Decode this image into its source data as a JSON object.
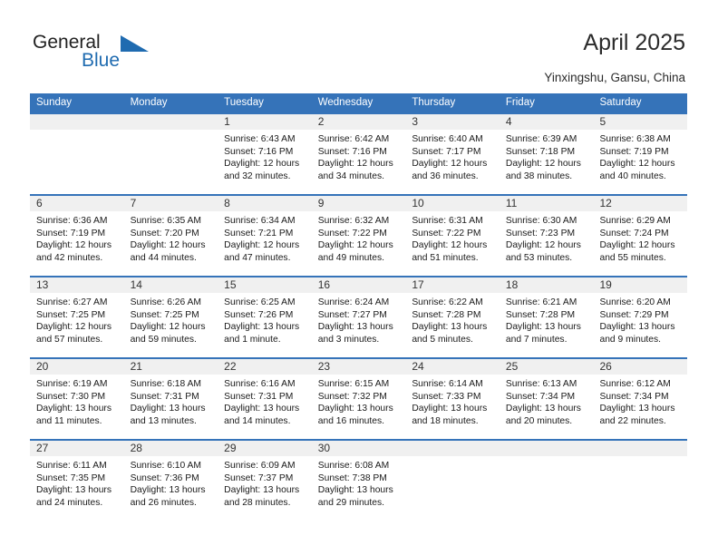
{
  "brand": {
    "name_part1": "General",
    "name_part2": "Blue",
    "accent_color": "#1f6bb0"
  },
  "header": {
    "title": "April 2025",
    "subtitle": "Yinxingshu, Gansu, China"
  },
  "calendar": {
    "header_bg": "#3573b9",
    "daynum_bg": "#f0f0f0",
    "weekdays": [
      "Sunday",
      "Monday",
      "Tuesday",
      "Wednesday",
      "Thursday",
      "Friday",
      "Saturday"
    ],
    "weeks": [
      [
        {
          "day": "",
          "sunrise": "",
          "sunset": "",
          "daylight1": "",
          "daylight2": ""
        },
        {
          "day": "",
          "sunrise": "",
          "sunset": "",
          "daylight1": "",
          "daylight2": ""
        },
        {
          "day": "1",
          "sunrise": "Sunrise: 6:43 AM",
          "sunset": "Sunset: 7:16 PM",
          "daylight1": "Daylight: 12 hours",
          "daylight2": "and 32 minutes."
        },
        {
          "day": "2",
          "sunrise": "Sunrise: 6:42 AM",
          "sunset": "Sunset: 7:16 PM",
          "daylight1": "Daylight: 12 hours",
          "daylight2": "and 34 minutes."
        },
        {
          "day": "3",
          "sunrise": "Sunrise: 6:40 AM",
          "sunset": "Sunset: 7:17 PM",
          "daylight1": "Daylight: 12 hours",
          "daylight2": "and 36 minutes."
        },
        {
          "day": "4",
          "sunrise": "Sunrise: 6:39 AM",
          "sunset": "Sunset: 7:18 PM",
          "daylight1": "Daylight: 12 hours",
          "daylight2": "and 38 minutes."
        },
        {
          "day": "5",
          "sunrise": "Sunrise: 6:38 AM",
          "sunset": "Sunset: 7:19 PM",
          "daylight1": "Daylight: 12 hours",
          "daylight2": "and 40 minutes."
        }
      ],
      [
        {
          "day": "6",
          "sunrise": "Sunrise: 6:36 AM",
          "sunset": "Sunset: 7:19 PM",
          "daylight1": "Daylight: 12 hours",
          "daylight2": "and 42 minutes."
        },
        {
          "day": "7",
          "sunrise": "Sunrise: 6:35 AM",
          "sunset": "Sunset: 7:20 PM",
          "daylight1": "Daylight: 12 hours",
          "daylight2": "and 44 minutes."
        },
        {
          "day": "8",
          "sunrise": "Sunrise: 6:34 AM",
          "sunset": "Sunset: 7:21 PM",
          "daylight1": "Daylight: 12 hours",
          "daylight2": "and 47 minutes."
        },
        {
          "day": "9",
          "sunrise": "Sunrise: 6:32 AM",
          "sunset": "Sunset: 7:22 PM",
          "daylight1": "Daylight: 12 hours",
          "daylight2": "and 49 minutes."
        },
        {
          "day": "10",
          "sunrise": "Sunrise: 6:31 AM",
          "sunset": "Sunset: 7:22 PM",
          "daylight1": "Daylight: 12 hours",
          "daylight2": "and 51 minutes."
        },
        {
          "day": "11",
          "sunrise": "Sunrise: 6:30 AM",
          "sunset": "Sunset: 7:23 PM",
          "daylight1": "Daylight: 12 hours",
          "daylight2": "and 53 minutes."
        },
        {
          "day": "12",
          "sunrise": "Sunrise: 6:29 AM",
          "sunset": "Sunset: 7:24 PM",
          "daylight1": "Daylight: 12 hours",
          "daylight2": "and 55 minutes."
        }
      ],
      [
        {
          "day": "13",
          "sunrise": "Sunrise: 6:27 AM",
          "sunset": "Sunset: 7:25 PM",
          "daylight1": "Daylight: 12 hours",
          "daylight2": "and 57 minutes."
        },
        {
          "day": "14",
          "sunrise": "Sunrise: 6:26 AM",
          "sunset": "Sunset: 7:25 PM",
          "daylight1": "Daylight: 12 hours",
          "daylight2": "and 59 minutes."
        },
        {
          "day": "15",
          "sunrise": "Sunrise: 6:25 AM",
          "sunset": "Sunset: 7:26 PM",
          "daylight1": "Daylight: 13 hours",
          "daylight2": "and 1 minute."
        },
        {
          "day": "16",
          "sunrise": "Sunrise: 6:24 AM",
          "sunset": "Sunset: 7:27 PM",
          "daylight1": "Daylight: 13 hours",
          "daylight2": "and 3 minutes."
        },
        {
          "day": "17",
          "sunrise": "Sunrise: 6:22 AM",
          "sunset": "Sunset: 7:28 PM",
          "daylight1": "Daylight: 13 hours",
          "daylight2": "and 5 minutes."
        },
        {
          "day": "18",
          "sunrise": "Sunrise: 6:21 AM",
          "sunset": "Sunset: 7:28 PM",
          "daylight1": "Daylight: 13 hours",
          "daylight2": "and 7 minutes."
        },
        {
          "day": "19",
          "sunrise": "Sunrise: 6:20 AM",
          "sunset": "Sunset: 7:29 PM",
          "daylight1": "Daylight: 13 hours",
          "daylight2": "and 9 minutes."
        }
      ],
      [
        {
          "day": "20",
          "sunrise": "Sunrise: 6:19 AM",
          "sunset": "Sunset: 7:30 PM",
          "daylight1": "Daylight: 13 hours",
          "daylight2": "and 11 minutes."
        },
        {
          "day": "21",
          "sunrise": "Sunrise: 6:18 AM",
          "sunset": "Sunset: 7:31 PM",
          "daylight1": "Daylight: 13 hours",
          "daylight2": "and 13 minutes."
        },
        {
          "day": "22",
          "sunrise": "Sunrise: 6:16 AM",
          "sunset": "Sunset: 7:31 PM",
          "daylight1": "Daylight: 13 hours",
          "daylight2": "and 14 minutes."
        },
        {
          "day": "23",
          "sunrise": "Sunrise: 6:15 AM",
          "sunset": "Sunset: 7:32 PM",
          "daylight1": "Daylight: 13 hours",
          "daylight2": "and 16 minutes."
        },
        {
          "day": "24",
          "sunrise": "Sunrise: 6:14 AM",
          "sunset": "Sunset: 7:33 PM",
          "daylight1": "Daylight: 13 hours",
          "daylight2": "and 18 minutes."
        },
        {
          "day": "25",
          "sunrise": "Sunrise: 6:13 AM",
          "sunset": "Sunset: 7:34 PM",
          "daylight1": "Daylight: 13 hours",
          "daylight2": "and 20 minutes."
        },
        {
          "day": "26",
          "sunrise": "Sunrise: 6:12 AM",
          "sunset": "Sunset: 7:34 PM",
          "daylight1": "Daylight: 13 hours",
          "daylight2": "and 22 minutes."
        }
      ],
      [
        {
          "day": "27",
          "sunrise": "Sunrise: 6:11 AM",
          "sunset": "Sunset: 7:35 PM",
          "daylight1": "Daylight: 13 hours",
          "daylight2": "and 24 minutes."
        },
        {
          "day": "28",
          "sunrise": "Sunrise: 6:10 AM",
          "sunset": "Sunset: 7:36 PM",
          "daylight1": "Daylight: 13 hours",
          "daylight2": "and 26 minutes."
        },
        {
          "day": "29",
          "sunrise": "Sunrise: 6:09 AM",
          "sunset": "Sunset: 7:37 PM",
          "daylight1": "Daylight: 13 hours",
          "daylight2": "and 28 minutes."
        },
        {
          "day": "30",
          "sunrise": "Sunrise: 6:08 AM",
          "sunset": "Sunset: 7:38 PM",
          "daylight1": "Daylight: 13 hours",
          "daylight2": "and 29 minutes."
        },
        {
          "day": "",
          "sunrise": "",
          "sunset": "",
          "daylight1": "",
          "daylight2": ""
        },
        {
          "day": "",
          "sunrise": "",
          "sunset": "",
          "daylight1": "",
          "daylight2": ""
        },
        {
          "day": "",
          "sunrise": "",
          "sunset": "",
          "daylight1": "",
          "daylight2": ""
        }
      ]
    ]
  }
}
